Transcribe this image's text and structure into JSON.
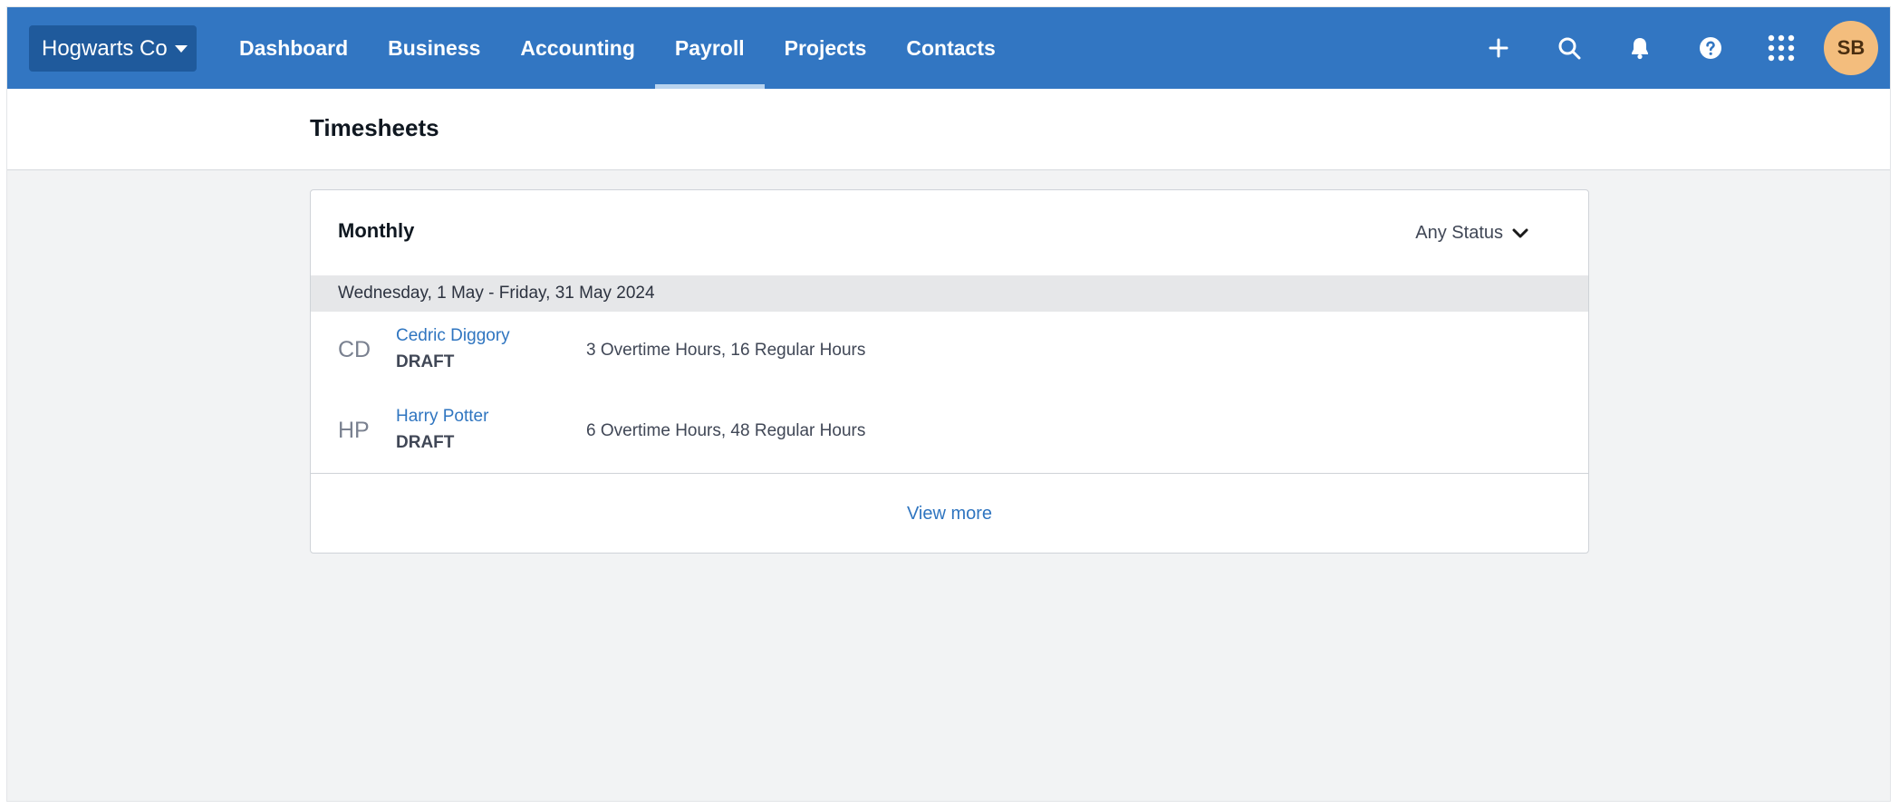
{
  "org": {
    "name": "Hogwarts Co"
  },
  "nav": {
    "tabs": [
      {
        "label": "Dashboard"
      },
      {
        "label": "Business"
      },
      {
        "label": "Accounting"
      },
      {
        "label": "Payroll",
        "active": true
      },
      {
        "label": "Projects"
      },
      {
        "label": "Contacts"
      }
    ],
    "icons": [
      "plus-icon",
      "search-icon",
      "bell-icon",
      "help-icon",
      "apps-grid-icon"
    ],
    "avatar_initials": "SB"
  },
  "page": {
    "title": "Timesheets"
  },
  "card": {
    "title": "Monthly",
    "status_filter": "Any Status",
    "period": "Wednesday, 1 May - Friday, 31 May 2024",
    "rows": [
      {
        "initials": "CD",
        "name": "Cedric Diggory",
        "status": "DRAFT",
        "hours": "3 Overtime Hours, 16 Regular Hours"
      },
      {
        "initials": "HP",
        "name": "Harry Potter",
        "status": "DRAFT",
        "hours": "6 Overtime Hours, 48 Regular Hours"
      }
    ],
    "view_more": "View more"
  },
  "colors": {
    "nav_bg": "#3276c2",
    "org_switcher_bg": "#1f5a9c",
    "link": "#2f75c0",
    "avatar_bg": "#f3bd7d",
    "page_bg": "#f2f3f4"
  }
}
